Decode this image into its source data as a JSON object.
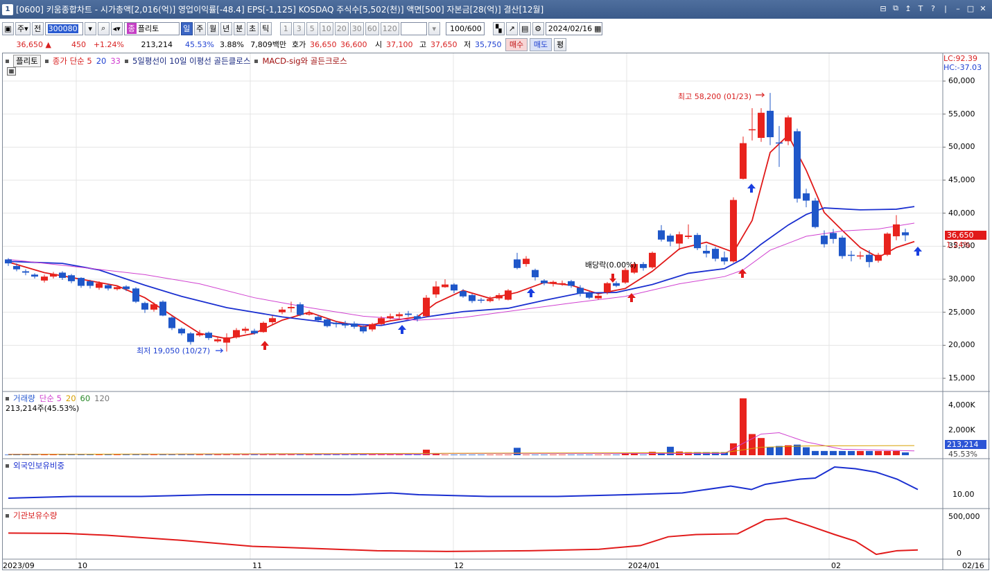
{
  "window": {
    "number": "1",
    "title": "[0600] 키움종합차트 - 시가총액[2,016(억)] 영업이익률[-48.4] EPS[-1,125] KOSDAQ 주식수[5,502(천)] 액면[500] 자본금[28(억)] 결산[12월]",
    "controls": [
      "⊟",
      "⧉",
      "↥",
      "T",
      "?",
      "|",
      "–",
      "□",
      "✕"
    ]
  },
  "toolbar": {
    "period_type": "주",
    "prev_label": "전",
    "stock_code": "300080",
    "stock_name": "플리토",
    "periods": [
      "일",
      "주",
      "월",
      "년",
      "분",
      "초",
      "틱"
    ],
    "active_period": "일",
    "intervals": [
      "1",
      "3",
      "5",
      "10",
      "20",
      "30",
      "60",
      "120"
    ],
    "count": "100",
    "count_total": "/600",
    "date": "2024/02/16"
  },
  "quote": {
    "price": "36,650",
    "arrow": "▲",
    "change": "450",
    "change_pct": "+1.24%",
    "volume": "213,214",
    "volume_ratio": "45.53%",
    "turnover": "3.88%",
    "amount": "7,809백만",
    "ask_label": "호가",
    "ask": "36,650",
    "bid": "36,600",
    "open_label": "시",
    "open": "37,100",
    "high_label": "고",
    "high": "37,650",
    "low_label": "저",
    "low": "35,750",
    "buy_label": "매수",
    "sell_label": "매도",
    "eval_label": "평"
  },
  "price_panel": {
    "name": "플리토",
    "ma_legend": "종가 단순 5",
    "ma_20": "20",
    "ma_33": "33",
    "signal1": "5일평선이 10일 이평선 골든클로스",
    "signal2": "MACD-sig와 골든크로스",
    "lc": "LC:92.39",
    "hc": "HC:-37.03",
    "high_annotation": "최고 58,200 (01/23)",
    "low_annotation": "최저 19,050 (10/27)",
    "dividend_annotation": "배당락(0.00%)",
    "current_price": "36,650",
    "current_pct": "1.24%",
    "y_ticks": [
      "60,000",
      "55,000",
      "50,000",
      "45,000",
      "40,000",
      "35,000",
      "30,000",
      "25,000",
      "20,000",
      "15,000"
    ]
  },
  "volume_panel": {
    "title": "거래량",
    "ma_label": "단순 5",
    "ma20": "20",
    "ma60": "60",
    "ma120": "120",
    "sub": "213,214주(45.53%)",
    "y_ticks": [
      "4,000K",
      "2,000K"
    ],
    "tag_value": "213,214",
    "tag_pct": "45.53%"
  },
  "foreign_panel": {
    "title": "외국인보유비중",
    "y_ticks": [
      "10.00"
    ]
  },
  "inst_panel": {
    "title": "기관보유수량",
    "y_ticks": [
      "500,000",
      "0"
    ]
  },
  "x_axis": {
    "labels": [
      "2023/09",
      "10",
      "11",
      "12",
      "2024/01",
      "02",
      "02/16"
    ]
  },
  "colors": {
    "up": "#e8231d",
    "down": "#1f57c9",
    "ma5": "#e01818",
    "ma20": "#1a2fd0",
    "ma33": "#d040d0"
  }
}
